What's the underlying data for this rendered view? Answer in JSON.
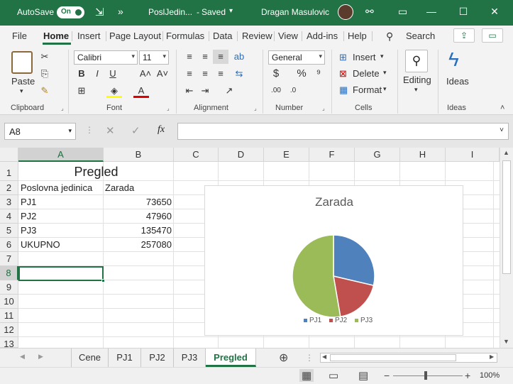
{
  "titlebar": {
    "autosave_label": "AutoSave",
    "autosave_state": "On",
    "filename": "PoslJedin...",
    "saved_status": "Saved",
    "user": "Dragan Masulovic",
    "overflow": "»"
  },
  "menu": {
    "tabs": [
      "File",
      "Home",
      "Insert",
      "Page Layout",
      "Formulas",
      "Data",
      "Review",
      "View",
      "Add-ins",
      "Help"
    ],
    "active": "Home",
    "search": "Search"
  },
  "ribbon": {
    "clipboard": {
      "paste": "Paste",
      "label": "Clipboard"
    },
    "font": {
      "name": "Calibri",
      "size": "11",
      "label": "Font"
    },
    "alignment": {
      "label": "Alignment"
    },
    "number": {
      "format": "General",
      "label": "Number"
    },
    "cells": {
      "insert": "Insert",
      "delete": "Delete",
      "format": "Format",
      "label": "Cells"
    },
    "editing": {
      "label": "Editing"
    },
    "ideas": {
      "button": "Ideas",
      "label": "Ideas"
    }
  },
  "formulabar": {
    "namebox": "A8",
    "formula": "",
    "fx": "fx"
  },
  "grid": {
    "columns": [
      "A",
      "B",
      "C",
      "D",
      "E",
      "F",
      "G",
      "H",
      "I"
    ],
    "rows": [
      "1",
      "2",
      "3",
      "4",
      "5",
      "6",
      "7",
      "8",
      "9",
      "10",
      "11",
      "12",
      "13"
    ],
    "selected_cell": "A8",
    "title": "Pregled",
    "header": {
      "a": "Poslovna jedinica",
      "b": "Zarada"
    },
    "data": [
      {
        "a": "PJ1",
        "b": "73650"
      },
      {
        "a": "PJ2",
        "b": "47960"
      },
      {
        "a": "PJ3",
        "b": "135470"
      },
      {
        "a": "UKUPNO",
        "b": "257080"
      }
    ]
  },
  "chart_data": {
    "type": "pie",
    "title": "Zarada",
    "categories": [
      "PJ1",
      "PJ2",
      "PJ3"
    ],
    "values": [
      73650,
      47960,
      135470
    ],
    "colors": [
      "#4f81bd",
      "#c0504d",
      "#9bbb59"
    ],
    "legend": "bottom"
  },
  "sheets": {
    "tabs": [
      "Cene",
      "PJ1",
      "PJ2",
      "PJ3",
      "Pregled"
    ],
    "active": "Pregled"
  },
  "status": {
    "zoom": "100%"
  }
}
